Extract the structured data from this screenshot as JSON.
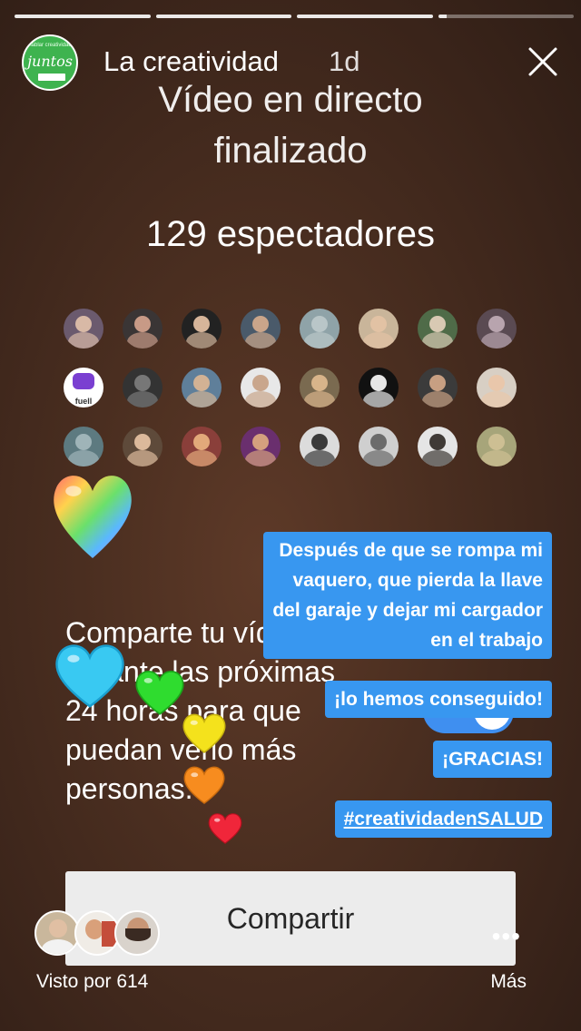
{
  "header": {
    "username": "La creatividad",
    "time_ago": "1d",
    "avatar_logo_text": "juntos",
    "avatar_logo_small_text": "hablar creatividad"
  },
  "live": {
    "title_line1": "Vídeo en directo",
    "title_line2": "finalizado",
    "viewers": "129 espectadores"
  },
  "viewer_avatars": [
    {
      "bg": "#6b5a6e",
      "fg": "#d8b9a6"
    },
    {
      "bg": "#3a3535",
      "fg": "#c89a86"
    },
    {
      "bg": "#222222",
      "fg": "#d6b59a"
    },
    {
      "bg": "#4a5a6a",
      "fg": "#caa58a"
    },
    {
      "bg": "#8fa3a8",
      "fg": "#b9c6c8"
    },
    {
      "bg": "#c9b59a",
      "fg": "#e2c2a4"
    },
    {
      "bg": "#4f6b48",
      "fg": "#d8c9b3"
    },
    {
      "bg": "#5a4a52",
      "fg": "#b8a4ae"
    },
    {
      "bg": "#ffffff",
      "fg": "#7a3fd1",
      "label": "fuell"
    },
    {
      "bg": "#333333",
      "fg": "#777777"
    },
    {
      "bg": "#5f7f9a",
      "fg": "#d2b294"
    },
    {
      "bg": "#e8e8e8",
      "fg": "#c9a68c"
    },
    {
      "bg": "#7a6a50",
      "fg": "#d8b48a"
    },
    {
      "bg": "#111111",
      "fg": "#e6e6e6"
    },
    {
      "bg": "#3b3b3b",
      "fg": "#c79f82"
    },
    {
      "bg": "#d8cfc4",
      "fg": "#e9c7ab"
    },
    {
      "bg": "#5d7a80",
      "fg": "#9fb4b8"
    },
    {
      "bg": "#5e4a3a",
      "fg": "#dbb99b"
    },
    {
      "bg": "#8a3f3a",
      "fg": "#e2a97a"
    },
    {
      "bg": "#6a2f6e",
      "fg": "#d4a07e"
    },
    {
      "bg": "#dcdcdc",
      "fg": "#3a3a3a"
    },
    {
      "bg": "#cfcfcf",
      "fg": "#6b6b6b"
    },
    {
      "bg": "#e5e5e5",
      "fg": "#3f3a36"
    },
    {
      "bg": "#a7a57a",
      "fg": "#cdbf93"
    }
  ],
  "share_text": {
    "line1": "Comparte tu vídeo",
    "line2": "durante las próximas",
    "line3": "24 horas para que",
    "line4": "puedan verlo más",
    "line5": "personas."
  },
  "stickers": {
    "s1_line1": "Después de que se rompa mi",
    "s1_line2": "vaquero, que pierda la llave",
    "s1_line3": "del garaje y dejar mi cargador",
    "s1_line4": "en el trabajo",
    "s2": "¡lo hemos conseguido!",
    "s3": "¡GRACIAS!",
    "s4": "#creatividadenSALUD"
  },
  "footer": {
    "share_button": "Compartir",
    "seen_by": "Visto por 614",
    "more_dots": "•••",
    "more_label": "Más"
  },
  "colors": {
    "sticker_blue": "#3897f0",
    "logo_green": "#3eb34f"
  }
}
